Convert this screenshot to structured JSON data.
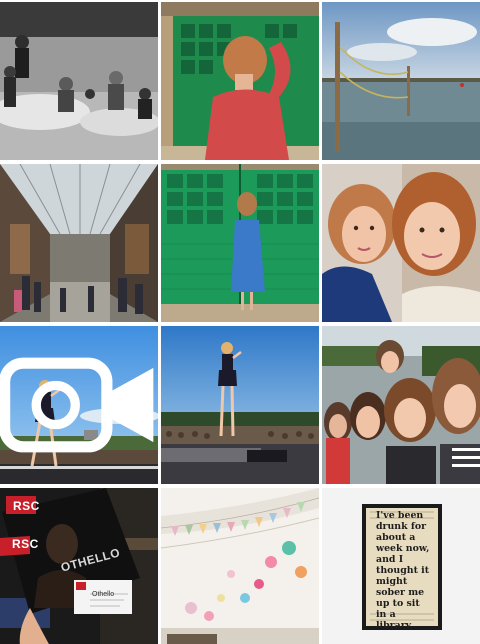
{
  "grid": {
    "tiles": [
      {
        "id": "tile-1",
        "kind": "photo",
        "subject": "children-splashing-sea-bw"
      },
      {
        "id": "tile-2",
        "kind": "photo",
        "subject": "woman-red-top-green-door"
      },
      {
        "id": "tile-3",
        "kind": "photo",
        "subject": "harbour-posts-water"
      },
      {
        "id": "tile-4",
        "kind": "photo",
        "subject": "shopping-arcade"
      },
      {
        "id": "tile-5",
        "kind": "photo",
        "subject": "woman-blue-dress-green-doors"
      },
      {
        "id": "tile-6",
        "kind": "photo",
        "subject": "two-girls-selfie"
      },
      {
        "id": "tile-7",
        "kind": "video",
        "subject": "concert-performer-stage"
      },
      {
        "id": "tile-8",
        "kind": "photo",
        "subject": "concert-performer-crowd"
      },
      {
        "id": "tile-9",
        "kind": "photo",
        "subject": "group-of-friends-selfie"
      },
      {
        "id": "tile-10",
        "kind": "photo",
        "subject": "theatre-programme-ticket"
      },
      {
        "id": "tile-11",
        "kind": "photo",
        "subject": "marquee-bunting-pompoms"
      },
      {
        "id": "tile-12",
        "kind": "photo",
        "subject": "framed-book-quote"
      }
    ],
    "video_icon": "video-camera-icon"
  },
  "texts": {
    "rsc_logo_1": "RSC",
    "rsc_logo_2": "RSC",
    "programme_title": "OTHELLO",
    "ticket_label": "Othello",
    "book_quote": "I've been\ndrunk for\nabout a\nweek now,\nand I\nthought it\nmight\nsober me\nup to sit\nin a library."
  }
}
